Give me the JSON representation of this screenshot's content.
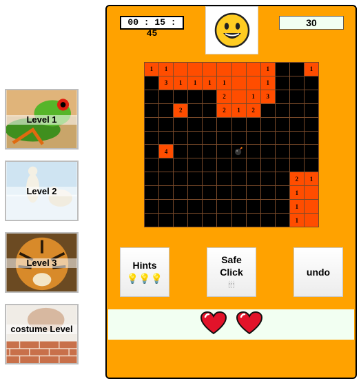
{
  "levels": [
    {
      "label": "Level 1"
    },
    {
      "label": "Level 2"
    },
    {
      "label": "Level 3"
    },
    {
      "label": "costume Level"
    }
  ],
  "timer": "00 : 15 : 45",
  "mine_counter": "30",
  "face_icon": "smiley-face-icon",
  "board": {
    "rows": 12,
    "cols": 12,
    "cells": [
      [
        "1",
        "1",
        "",
        "",
        "",
        "",
        "",
        "",
        "1",
        "x",
        "x",
        "1"
      ],
      [
        "x",
        "3",
        "1",
        "1",
        "1",
        "1",
        "",
        "",
        "1",
        "x",
        "x",
        "x"
      ],
      [
        "x",
        "x",
        "x",
        "x",
        "x",
        "2",
        "",
        "1",
        "3",
        "x",
        "x",
        "x"
      ],
      [
        "x",
        "x",
        "2",
        "x",
        "x",
        "2",
        "1",
        "2",
        "x",
        "x",
        "x",
        "x"
      ],
      [
        "x",
        "x",
        "x",
        "x",
        "x",
        "x",
        "x",
        "x",
        "x",
        "x",
        "x",
        "x"
      ],
      [
        "x",
        "x",
        "x",
        "x",
        "x",
        "x",
        "x",
        "x",
        "x",
        "x",
        "x",
        "x"
      ],
      [
        "x",
        "4",
        "x",
        "x",
        "x",
        "x",
        "bomb",
        "x",
        "x",
        "x",
        "x",
        "x"
      ],
      [
        "x",
        "x",
        "x",
        "x",
        "x",
        "x",
        "x",
        "x",
        "x",
        "x",
        "x",
        "x"
      ],
      [
        "x",
        "x",
        "x",
        "x",
        "x",
        "x",
        "x",
        "x",
        "x",
        "x",
        "2",
        "1"
      ],
      [
        "x",
        "x",
        "x",
        "x",
        "x",
        "x",
        "x",
        "x",
        "x",
        "x",
        "1",
        ""
      ],
      [
        "x",
        "x",
        "x",
        "x",
        "x",
        "x",
        "x",
        "x",
        "x",
        "x",
        "1",
        ""
      ],
      [
        "x",
        "x",
        "x",
        "x",
        "x",
        "x",
        "x",
        "x",
        "x",
        "x",
        "1",
        ""
      ]
    ]
  },
  "tools": {
    "hints": {
      "label": "Hints",
      "icons": "💡💡💡"
    },
    "safe_click": {
      "label_line1": "Safe",
      "label_line2": "Click",
      "icons": "🕯🕯🕯"
    },
    "undo": {
      "label": "undo"
    }
  },
  "lives": 2,
  "colors": {
    "panel": "#ffa200",
    "open_cell": "#ff4d00",
    "hidden_cell": "#000000",
    "lives_bar": "#f2fff2",
    "heart": "#e2132a"
  }
}
